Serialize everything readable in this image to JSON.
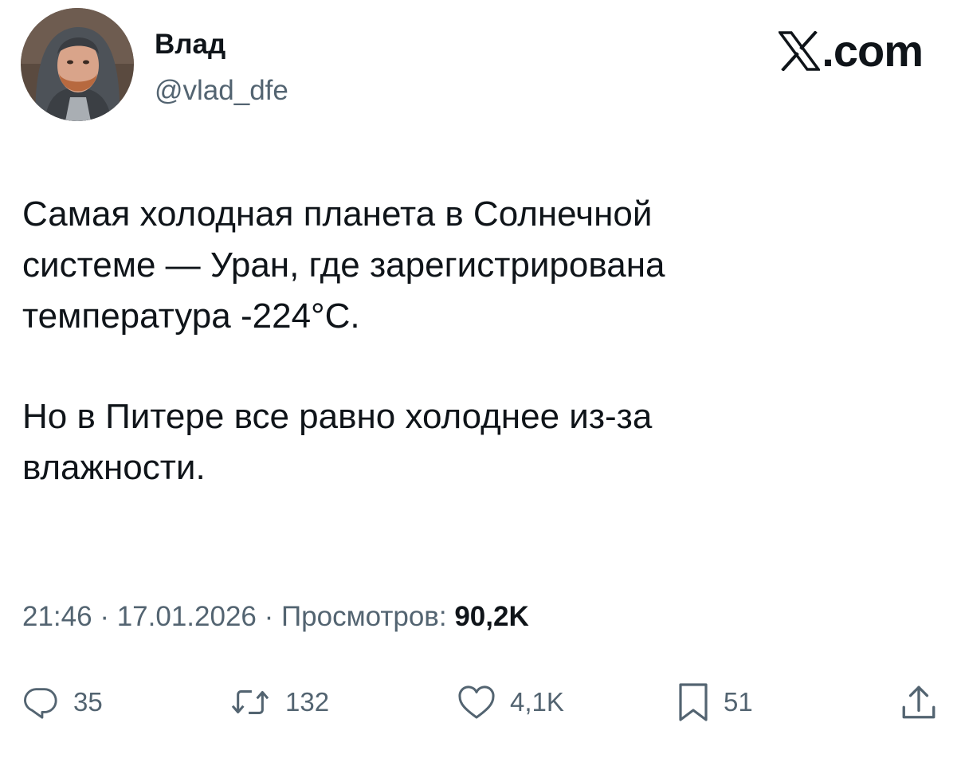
{
  "author": {
    "display_name": "Влад",
    "handle": "@vlad_dfe"
  },
  "brand": {
    "text": ".com",
    "icon": "x-logo-icon"
  },
  "tweet": {
    "paragraphs": [
      "Самая холодная планета в Солнечной\nсистеме — Уран, где зарегистрирована\nтемпература -224°C.",
      "Но в Питере все равно холоднее из-за\nвлажности."
    ]
  },
  "meta": {
    "time": "21:46",
    "separator": " · ",
    "date": "17.01.2026",
    "views_label": "Просмотров: ",
    "views_count": "90,2K"
  },
  "actions": {
    "reply": {
      "icon": "reply-icon",
      "count": "35"
    },
    "retweet": {
      "icon": "retweet-icon",
      "count": "132"
    },
    "like": {
      "icon": "heart-icon",
      "count": "4,1K"
    },
    "bookmark": {
      "icon": "bookmark-icon",
      "count": "51"
    },
    "share": {
      "icon": "share-icon"
    }
  },
  "colors": {
    "text_primary": "#0f1419",
    "text_secondary": "#536471",
    "background": "#ffffff"
  }
}
